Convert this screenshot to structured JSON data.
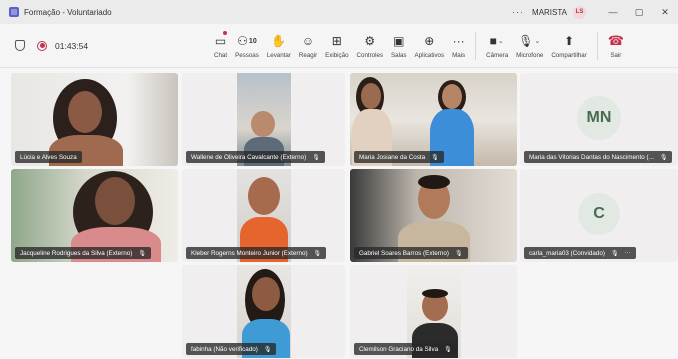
{
  "window": {
    "title": "Formação - Voluntariado",
    "more": "···",
    "org": "MARISTA",
    "avatar_initials": "LS",
    "minimize": "—",
    "maximize": "▢",
    "close": "✕"
  },
  "meeting": {
    "timer": "01:43:54"
  },
  "toolbar": {
    "chat": "Chat",
    "people": "Pessoas",
    "people_count": "10",
    "raise": "Levantar",
    "react": "Reagir",
    "view": "Exibição",
    "controls": "Controles",
    "rooms": "Salas",
    "apps": "Aplicativos",
    "more": "Mais",
    "camera": "Câmera",
    "mic": "Microfone",
    "share": "Compartilhar",
    "leave": "Sair"
  },
  "participants": [
    {
      "name": "Lúcia e Alves Souza"
    },
    {
      "name": "Wallene de Oliveira Cavalcante (Externo)"
    },
    {
      "name": "Maria Josiane da Costa"
    },
    {
      "name": "Maria das Vitorias Dantas do Nascimento (...",
      "initials": "MN"
    },
    {
      "name": "Jacqueline Rodrigues da Silva (Externo)"
    },
    {
      "name": "Kleber Rogerns Monteiro Junior (Externo)"
    },
    {
      "name": "Gabriel Soares Barros (Externo)"
    },
    {
      "name": "carla_maria03 (Convidado)",
      "initials": "C",
      "more": "···"
    },
    {
      "name": "fabinha (Não verificado)"
    },
    {
      "name": "Clemilson Graciano da Silva"
    }
  ],
  "colors": {
    "accent": "#5b5fc7",
    "leave": "#c4314b"
  }
}
